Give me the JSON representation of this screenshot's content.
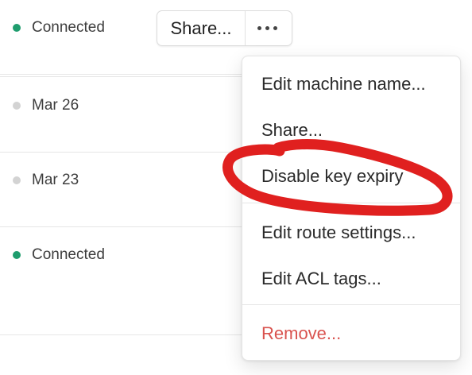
{
  "rows": [
    {
      "status": "Connected",
      "online": true
    },
    {
      "status": "Mar 26",
      "online": false
    },
    {
      "status": "Mar 23",
      "online": false
    },
    {
      "status": "Connected",
      "online": true
    }
  ],
  "actions": {
    "share_label": "Share...",
    "more_icon": "ellipsis-horizontal-icon"
  },
  "menu": {
    "items": [
      {
        "label": "Edit machine name..."
      },
      {
        "label": "Share..."
      },
      {
        "label": "Disable key expiry"
      },
      {
        "label": "Edit route settings..."
      },
      {
        "label": "Edit ACL tags..."
      },
      {
        "label": "Remove..."
      }
    ]
  },
  "colors": {
    "online": "#1f9d6e",
    "offline": "#d3d3d3",
    "danger": "#d9534f",
    "annotation": "#e0201f"
  }
}
